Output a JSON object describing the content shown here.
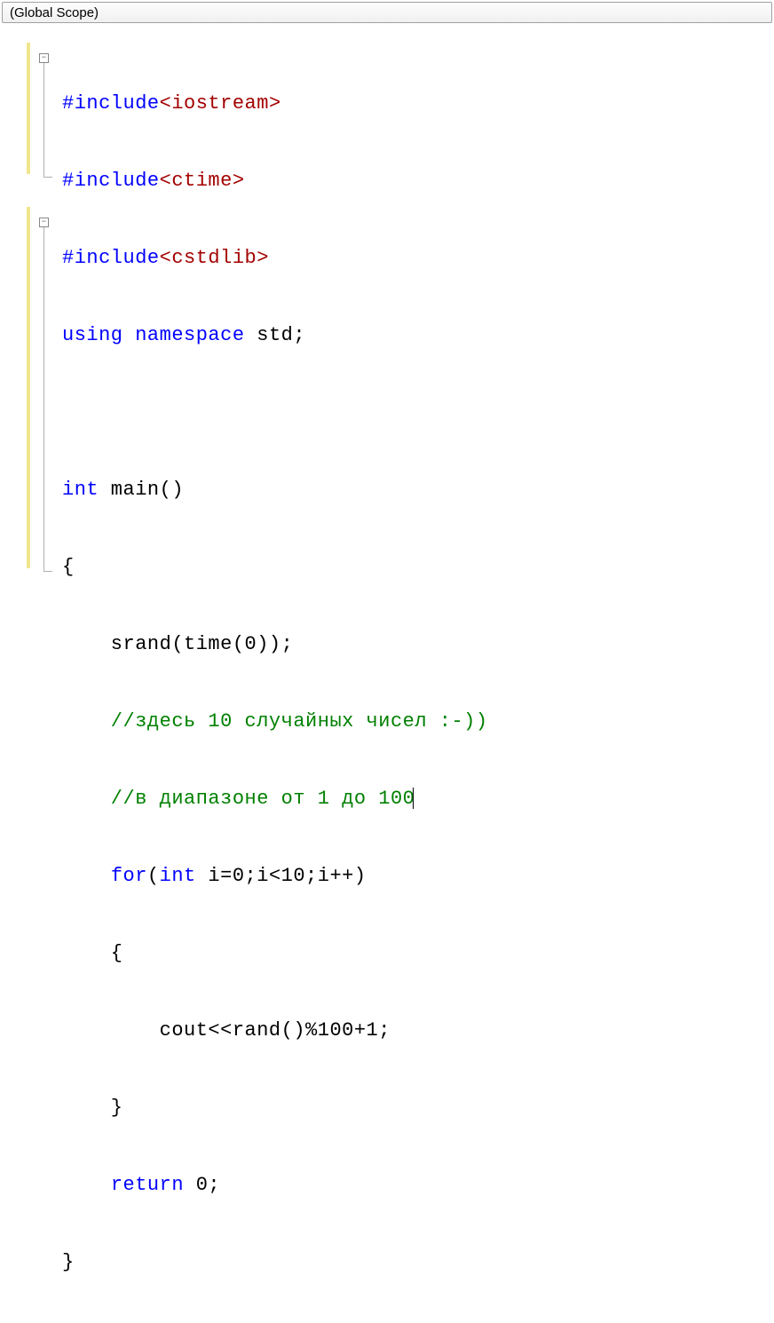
{
  "scope": "(Global Scope)",
  "fold": {
    "minus": "−"
  },
  "code": {
    "l1a": "#include",
    "l1b": "<iostream>",
    "l2a": "#include",
    "l2b": "<ctime>",
    "l3a": "#include",
    "l3b": "<cstdlib>",
    "l4a": "using",
    "l4b": " ",
    "l4c": "namespace",
    "l4d": " std;",
    "l5": "",
    "l6a": "int",
    "l6b": " main()",
    "l7": "{",
    "l8": "    srand(time(0));",
    "l9": "    //здесь 10 случайных чисел :-))",
    "l10": "    //в диапазоне от 1 до 100",
    "l11a": "    ",
    "l11b": "for",
    "l11c": "(",
    "l11d": "int",
    "l11e": " i=0;i<10;i++)",
    "l12": "    {",
    "l13": "        cout<<rand()%100+1;",
    "l14": "    }",
    "l15a": "    ",
    "l15b": "return",
    "l15c": " 0;",
    "l16": "}"
  }
}
